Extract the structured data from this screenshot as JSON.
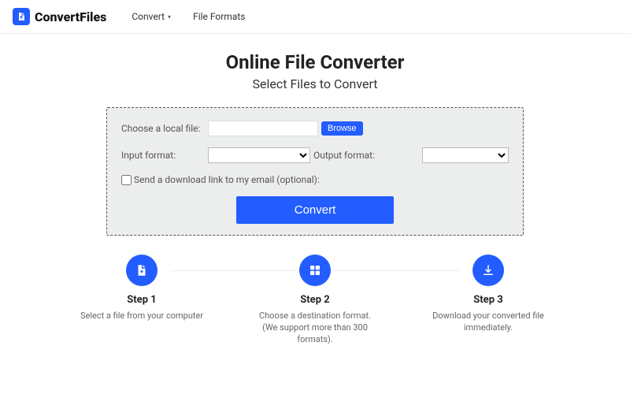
{
  "brand": "ConvertFiles",
  "nav": {
    "convert": "Convert",
    "formats": "File Formats"
  },
  "page": {
    "title": "Online File Converter",
    "subtitle": "Select Files to Convert"
  },
  "form": {
    "choose_label": "Choose a local file:",
    "browse": "Browse",
    "input_format_label": "Input format:",
    "output_format_label": "Output format:",
    "email_label": "Send a download link to my email (optional):",
    "convert": "Convert"
  },
  "steps": [
    {
      "title": "Step 1",
      "desc": "Select a file from your computer"
    },
    {
      "title": "Step 2",
      "desc": "Choose a destination format. (We support more than 300 formats)."
    },
    {
      "title": "Step 3",
      "desc": "Download your converted file immediately."
    }
  ]
}
